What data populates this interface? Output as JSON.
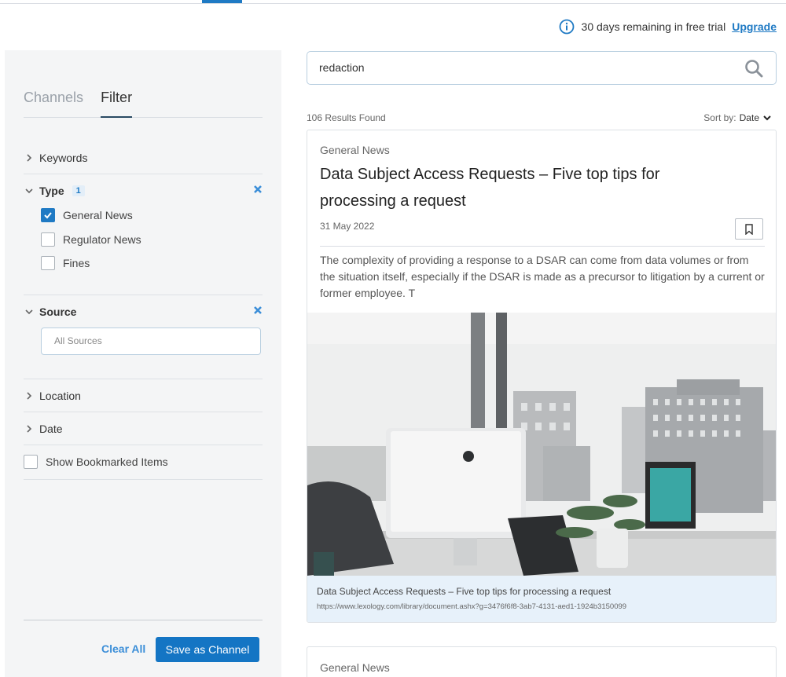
{
  "trial": {
    "message": "30 days remaining in free trial",
    "upgrade_label": "Upgrade"
  },
  "sidebar": {
    "tabs": [
      {
        "label": "Channels",
        "active": false
      },
      {
        "label": "Filter",
        "active": true
      }
    ],
    "keywords_label": "Keywords",
    "type": {
      "label": "Type",
      "count": "1",
      "options": [
        {
          "label": "General News",
          "checked": true
        },
        {
          "label": "Regulator News",
          "checked": false
        },
        {
          "label": "Fines",
          "checked": false
        }
      ]
    },
    "source": {
      "label": "Source",
      "placeholder": "All Sources"
    },
    "location_label": "Location",
    "date_label": "Date",
    "show_bookmarked_label": "Show Bookmarked Items",
    "clear_all_label": "Clear All",
    "save_channel_label": "Save as Channel"
  },
  "search": {
    "value": "redaction"
  },
  "results": {
    "count_text": "106 Results Found",
    "sort_label": "Sort by:",
    "sort_value": "Date",
    "items": [
      {
        "category": "General News",
        "title": "Data Subject Access Requests – Five top tips for processing a request",
        "date": "31 May 2022",
        "summary": "The complexity of providing a response to a DSAR can come from data volumes or from the situation itself, especially if the DSAR is made as a precursor to litigation by a current or former employee. T",
        "caption_title": "Data Subject Access Requests – Five top tips for processing a request",
        "caption_url": "https://www.lexology.com/library/document.ashx?g=3476f6f8-3ab7-4131-aed1-1924b3150099"
      },
      {
        "category": "General News"
      }
    ]
  },
  "colors": {
    "accent": "#1f7ac4",
    "button": "#1475c4",
    "sidebar_bg": "#f4f5f6",
    "caption_bg": "#e7f1fa"
  }
}
